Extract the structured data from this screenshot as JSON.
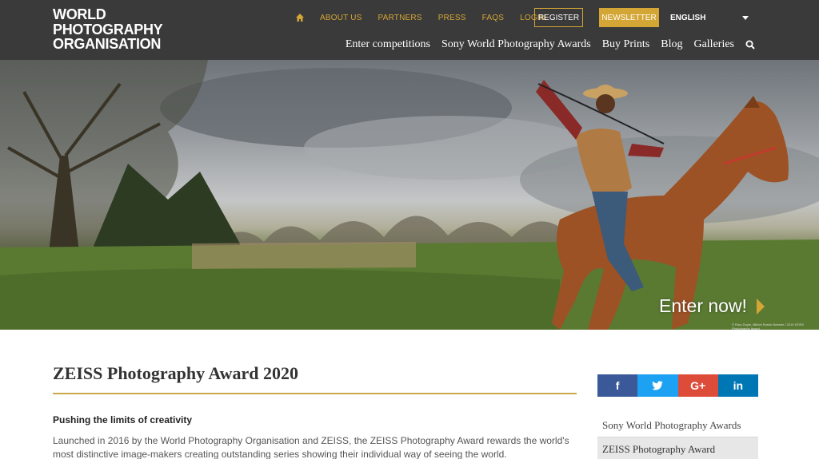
{
  "brand": {
    "logo_line1": "WORLD",
    "logo_line2": "PHOTOGRAPHY",
    "logo_line3": "ORGANISATION",
    "accent_color": "#d4a636",
    "header_bg": "#3a3a3a"
  },
  "topnav": {
    "home_icon": "home-icon",
    "items": [
      "ABOUT US",
      "PARTNERS",
      "PRESS",
      "FAQS",
      "LOGIN"
    ],
    "register_label": "REGISTER",
    "newsletter_label": "NEWSLETTER",
    "language": "ENGLISH"
  },
  "mainnav": {
    "items": [
      "Enter competitions",
      "Sony World Photography Awards",
      "Buy Prints",
      "Blog",
      "Galleries"
    ],
    "search_icon": "search-icon"
  },
  "hero": {
    "cta_label": "Enter now!",
    "credit": "© Rory Doyle, Mikhel Rushu Neesen / 2019 ZEISS Photography Award"
  },
  "article": {
    "title": "ZEISS Photography Award 2020",
    "subhead": "Pushing the limits of creativity",
    "paragraph": "Launched in 2016 by the World Photography Organisation and ZEISS, the ZEISS Photography Award rewards the world's most distinctive image-makers creating outstanding series showing their individual way of seeing the world."
  },
  "sidebar": {
    "social": [
      {
        "icon": "facebook-icon",
        "glyph": "f",
        "color": "#3b5998"
      },
      {
        "icon": "twitter-icon",
        "glyph": "t",
        "color": "#1da1f2"
      },
      {
        "icon": "google-plus-icon",
        "glyph": "G+",
        "color": "#dd4b39"
      },
      {
        "icon": "linkedin-icon",
        "glyph": "in",
        "color": "#0077b5"
      }
    ],
    "links": [
      "Sony World Photography Awards",
      "ZEISS Photography Award"
    ]
  }
}
